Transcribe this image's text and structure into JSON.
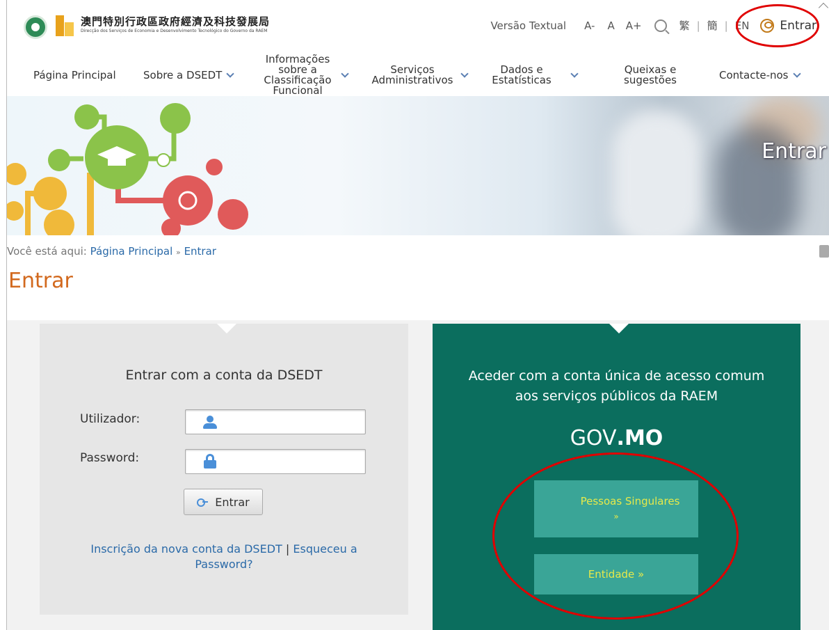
{
  "header": {
    "org_name_cn": "澳門特別行政區政府經濟及科技發展局",
    "org_name_pt": "Direcção dos Serviços de Economia e Desenvolvimento Tecnológico do Governo da RAEM",
    "text_version": "Versão Textual",
    "font_decrease": "A-",
    "font_normal": "A",
    "font_increase": "A+",
    "lang_traditional": "繁",
    "lang_simplified": "簡",
    "lang_en": "EN",
    "login_label": "Entrar",
    "separator": "|"
  },
  "nav": {
    "items": [
      {
        "label": "Página Principal",
        "has_dropdown": false
      },
      {
        "label": "Sobre a DSEDT",
        "has_dropdown": true
      },
      {
        "label": "Informações sobre a Classificação Funcional",
        "has_dropdown": true
      },
      {
        "label": "Serviços Administrativos",
        "has_dropdown": true
      },
      {
        "label": "Dados e Estatísticas",
        "has_dropdown": true
      },
      {
        "label": "Queixas e sugestões",
        "has_dropdown": false
      },
      {
        "label": "Contacte-nos",
        "has_dropdown": true
      }
    ]
  },
  "banner": {
    "title": "Entrar"
  },
  "breadcrumb": {
    "prefix": "Você está aqui:",
    "home": "Página Principal",
    "separator": "»",
    "current": "Entrar"
  },
  "page": {
    "title": "Entrar"
  },
  "login_form": {
    "heading": "Entrar com a conta da DSEDT",
    "username_label": "Utilizador:",
    "username_value": "",
    "password_label": "Password:",
    "password_value": "",
    "submit_label": "Entrar",
    "register_link": "Inscrição da nova conta da DSEDT",
    "link_separator": "|",
    "forgot_link": "Esqueceu a Password?"
  },
  "gov_login": {
    "heading_line1": "Aceder com a conta única de acesso comum",
    "heading_line2": "aos serviços públicos da RAEM",
    "logo_prefix": "GOV",
    "logo_suffix": ".MO",
    "individual_label": "Pessoas Singulares",
    "individual_arrow": "»",
    "entity_label": "Entidade »"
  },
  "colors": {
    "accent_orange": "#d2691e",
    "link_blue": "#2b6aa8",
    "gov_panel": "#0b6e5e",
    "gov_button": "#3aa597",
    "gov_button_text": "#e6e94a",
    "annotation_red": "#e00000"
  },
  "icons": [
    "emblem-icon",
    "dsedt-logo-icon",
    "search-icon",
    "user-circle-icon",
    "chevron-down-icon",
    "user-icon",
    "lock-icon",
    "key-icon",
    "printer-icon"
  ]
}
